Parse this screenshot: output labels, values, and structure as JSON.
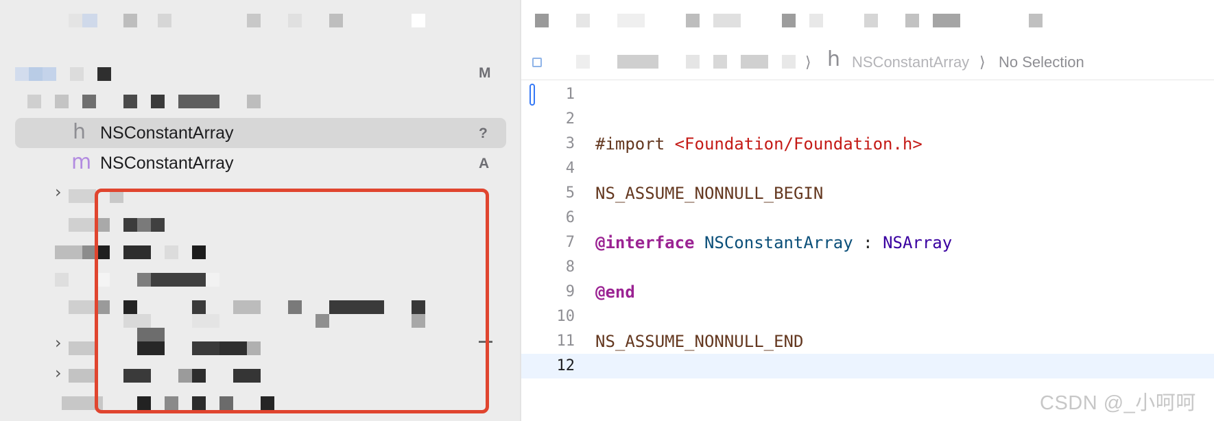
{
  "navigator": {
    "rows": [
      {
        "icon": "h-file-icon",
        "icon_glyph": "h",
        "name": "NSConstantArray",
        "status": "?",
        "selected": true
      },
      {
        "icon": "m-file-icon",
        "icon_glyph": "m",
        "name": "NSConstantArray",
        "status": "A",
        "selected": false
      }
    ],
    "top_row_status": "M",
    "disclosure_glyph": "›"
  },
  "jump_bar": {
    "file_icon_glyph": "h",
    "file_name": "NSConstantArray",
    "separator": "⟩",
    "selection": "No Selection"
  },
  "editor": {
    "current_line": 12,
    "lines": [
      {
        "number": "1",
        "tokens": []
      },
      {
        "number": "2",
        "tokens": []
      },
      {
        "number": "3",
        "tokens": [
          {
            "text": "#import ",
            "kind": "preproc"
          },
          {
            "text": "<Foundation/Foundation.h>",
            "kind": "string"
          }
        ]
      },
      {
        "number": "4",
        "tokens": []
      },
      {
        "number": "5",
        "tokens": [
          {
            "text": "NS_ASSUME_NONNULL_BEGIN",
            "kind": "macro"
          }
        ]
      },
      {
        "number": "6",
        "tokens": []
      },
      {
        "number": "7",
        "tokens": [
          {
            "text": "@interface",
            "kind": "keyword"
          },
          {
            "text": " ",
            "kind": "plain"
          },
          {
            "text": "NSConstantArray",
            "kind": "classdecl"
          },
          {
            "text": " : ",
            "kind": "plain"
          },
          {
            "text": "NSArray",
            "kind": "classref"
          }
        ]
      },
      {
        "number": "8",
        "tokens": []
      },
      {
        "number": "9",
        "tokens": [
          {
            "text": "@end",
            "kind": "keyword"
          }
        ]
      },
      {
        "number": "10",
        "tokens": []
      },
      {
        "number": "11",
        "tokens": [
          {
            "text": "NS_ASSUME_NONNULL_END",
            "kind": "macro"
          }
        ]
      },
      {
        "number": "12",
        "tokens": []
      }
    ]
  },
  "watermark": "CSDN @_小呵呵",
  "colors": {
    "selection_bg": "#d7d7d7",
    "highlight_box": "#e0452f",
    "current_line_bg": "#ecf4ff",
    "keyword": "#9b2393",
    "string": "#c41a16",
    "macro": "#643820",
    "class_decl": "#0b4f79",
    "class_ref": "#3900a0"
  }
}
